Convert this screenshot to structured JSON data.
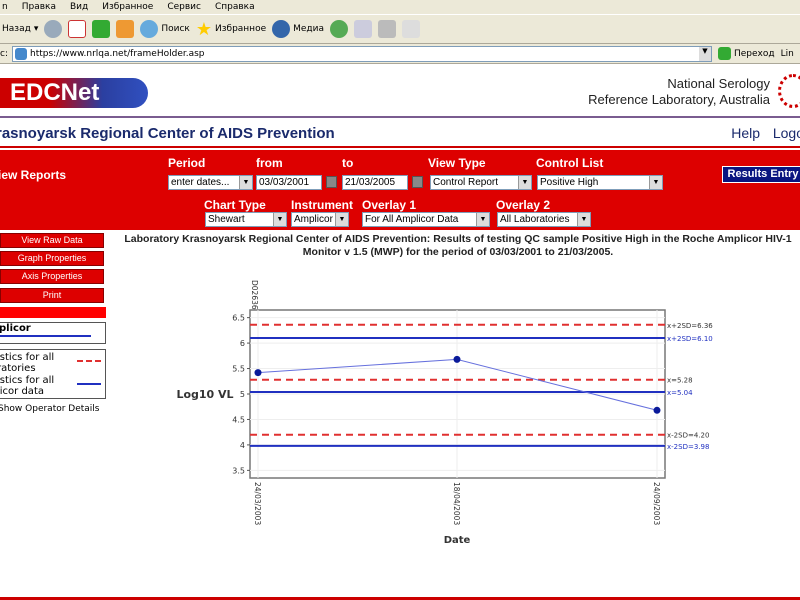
{
  "browser": {
    "menu": [
      "n",
      "Правка",
      "Вид",
      "Избранное",
      "Сервис",
      "Справка"
    ],
    "toolbar": {
      "back": "Назад",
      "search": "Поиск",
      "favorites": "Избранное",
      "media": "Медиа"
    },
    "address_label": "c:",
    "url": "https://www.nrlqa.net/frameHolder.asp",
    "go": "Переход",
    "links": "Lin"
  },
  "header": {
    "logo": "EDCNet",
    "org_line1": "National Serology",
    "org_line2": "Reference Laboratory, Australia"
  },
  "orgbar": {
    "name": "rasnoyarsk Regional Center of AIDS Prevention",
    "help": "Help",
    "logout": "Logo"
  },
  "controls": {
    "view_reports": "iew Reports",
    "period_label": "Period",
    "period_value": "enter dates...",
    "from_label": "from",
    "from_value": "03/03/2001",
    "to_label": "to",
    "to_value": "21/03/2005",
    "view_type_label": "View Type",
    "view_type_value": "Control Report",
    "control_list_label": "Control List",
    "control_list_value": "Positive High",
    "chart_type_label": "Chart Type",
    "chart_type_value": "Shewart",
    "instrument_label": "Instrument",
    "instrument_value": "Amplicor",
    "overlay1_label": "Overlay 1",
    "overlay1_value": "For All Amplicor Data",
    "overlay2_label": "Overlay 2",
    "overlay2_value": "All Laboratories",
    "results_entry": "Results Entry"
  },
  "sidebar": {
    "buttons": [
      "View Raw Data",
      "Graph Properties",
      "Axis Properties",
      "Print"
    ],
    "series_label": "plicor",
    "legend": [
      {
        "text1": "istics for all",
        "text2": "ratories",
        "style": "dashed",
        "color": "#e03030"
      },
      {
        "text1": "istics for all",
        "text2": "licor data",
        "style": "solid",
        "color": "#2030c0"
      }
    ],
    "show_operator": "Show Operator Details"
  },
  "chart_title": "Laboratory Krasnoyarsk Regional Center of AIDS Prevention: Results of testing QC sample Positive High in the Roche Amplicor HIV-1 Monitor v 1.5 (MWP) for the period of 03/03/2001 to 21/03/2005.",
  "chart_data": {
    "type": "line",
    "xlabel": "Date",
    "ylabel": "Log10 VL",
    "top_label": "D02636",
    "x": [
      "24/03/2003",
      "18/04/2003",
      "24/09/2003"
    ],
    "y": [
      5.42,
      5.68,
      4.68
    ],
    "ylim": [
      3.35,
      6.65
    ],
    "yticks": [
      3.5,
      4,
      4.5,
      5,
      5.5,
      6,
      6.5
    ],
    "grid": true,
    "series_color": "#2030c0",
    "reference_lines": [
      {
        "label": "x+2SD=6.36",
        "value": 6.36,
        "style": "dashed",
        "color": "#e03030"
      },
      {
        "label": "x+2SD=6.10",
        "value": 6.1,
        "style": "solid",
        "color": "#2030c0"
      },
      {
        "label": "x=5.28",
        "value": 5.28,
        "style": "dashed",
        "color": "#e03030"
      },
      {
        "label": "x=5.04",
        "value": 5.04,
        "style": "solid",
        "color": "#2030c0"
      },
      {
        "label": "x-2SD=4.20",
        "value": 4.2,
        "style": "dashed",
        "color": "#e03030"
      },
      {
        "label": "x-2SD=3.98",
        "value": 3.98,
        "style": "solid",
        "color": "#2030c0"
      }
    ]
  }
}
